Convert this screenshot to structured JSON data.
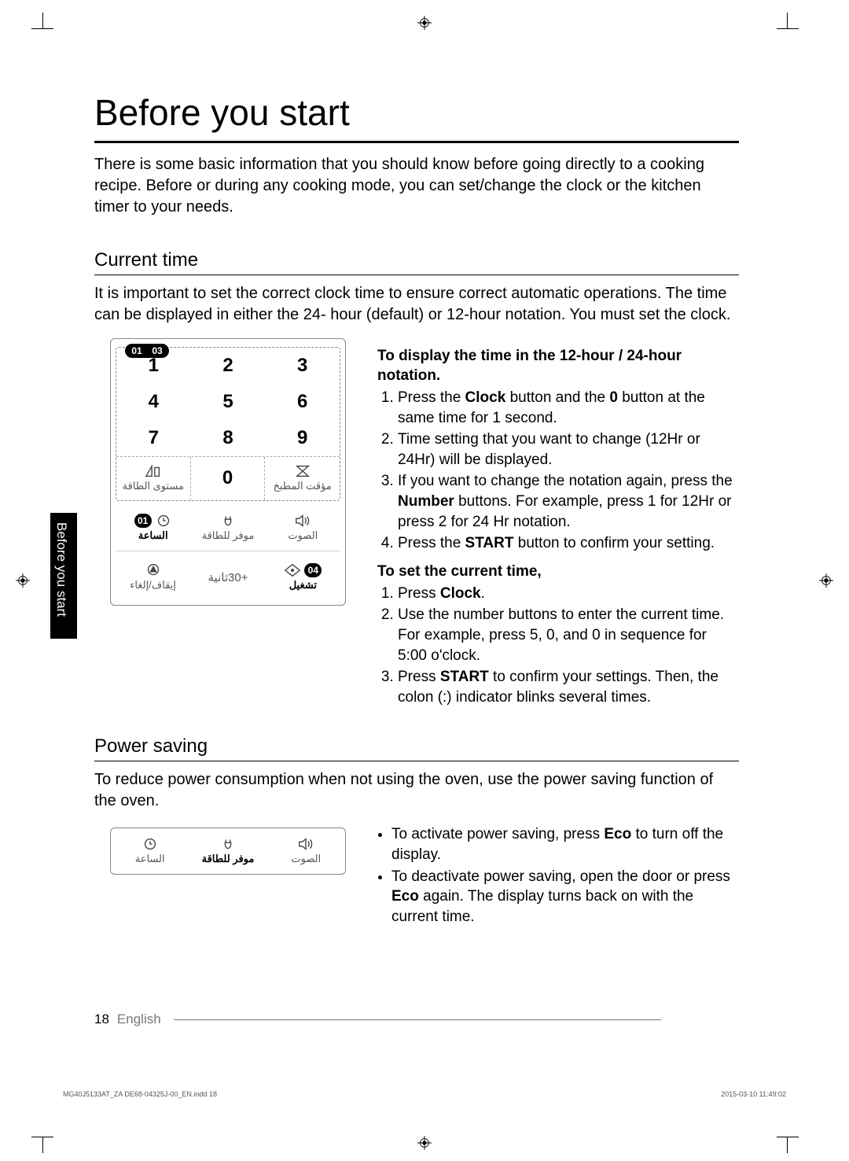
{
  "title": "Before you start",
  "intro": "There is some basic information that you should know before going directly to a cooking recipe. Before or during any cooking mode, you can set/change the clock or the kitchen timer to your needs.",
  "sidetab": "Before you start",
  "sections": {
    "current_time": {
      "heading": "Current time",
      "desc": "It is important to set the correct clock time to ensure correct automatic operations. The time can be displayed in either the 24- hour (default) or 12-hour notation. You must set the clock.",
      "notation_head": "To display the time in the 12-hour / 24-hour notation.",
      "notation_steps": [
        "Press the <b>Clock</b> button and the <b>0</b> button at the same time for 1 second.",
        "Time setting that you want to change (12Hr or 24Hr) will be displayed.",
        "If you want to change the notation again, press the <b>Number</b> buttons. For example, press 1 for 12Hr or press 2 for 24 Hr notation.",
        "Press the <b>START</b> button to confirm your setting."
      ],
      "settime_head": "To set the current time,",
      "settime_steps": [
        "Press <b>Clock</b>.",
        "Use the number buttons to enter the current time. For example, press 5, 0, and 0 in sequence for 5:00 o'clock.",
        "Press <b>START</b> to confirm your settings. Then, the colon (:) indicator blinks several times."
      ]
    },
    "power_saving": {
      "heading": "Power saving",
      "desc": "To reduce power consumption when not using the oven, use the power saving function of the oven.",
      "bullets": [
        "To activate power saving, press <b>Eco</b> to turn off the display.",
        "To deactivate power saving, open the door or press <b>Eco</b> again. The display turns back on with the current time."
      ]
    }
  },
  "panel": {
    "badges": {
      "b01": "01",
      "b03": "03",
      "b01b": "01",
      "b04": "04"
    },
    "keys": [
      "1",
      "2",
      "3",
      "4",
      "5",
      "6",
      "7",
      "8",
      "9"
    ],
    "zero": "0",
    "labels": {
      "power_level_ar": "مستوى الطاقة",
      "kitchen_timer_ar": "مؤقت المطبخ",
      "clock_ar": "الساعة",
      "eco_ar": "موفر للطاقة",
      "sound_ar": "الصوت",
      "stop_ar": "إيقاف/إلغاء",
      "plus30_ar": "+30ثانية",
      "start_ar": "تشغيل"
    }
  },
  "footer": {
    "page": "18",
    "lang": "English"
  },
  "tinyfoot": {
    "left": "MG40J5133AT_ZA DE68-04325J-00_EN.indd   18",
    "right": "2015-03-10   11:49:02"
  }
}
